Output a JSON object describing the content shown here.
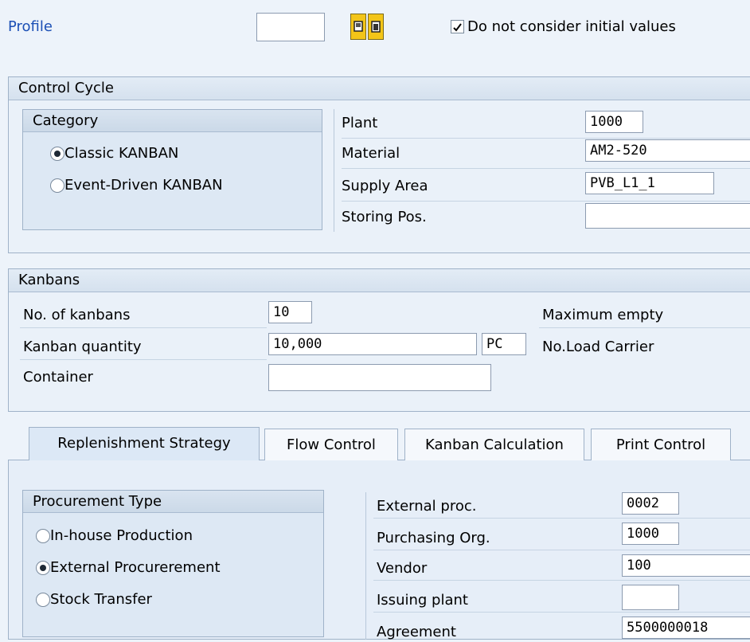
{
  "toolbar": {
    "profile_label": "Profile",
    "profile_value": "",
    "icon1": "expand-icon",
    "icon2": "collapse-icon",
    "checkbox_label": "Do not consider initial values",
    "checkbox_checked": true
  },
  "control_cycle": {
    "title": "Control Cycle",
    "category": {
      "title": "Category",
      "options": [
        {
          "label": "Classic KANBAN",
          "selected": true
        },
        {
          "label": "Event-Driven KANBAN",
          "selected": false
        }
      ]
    },
    "fields": [
      {
        "label": "Plant",
        "value": "1000"
      },
      {
        "label": "Material",
        "value": "AM2-520"
      },
      {
        "label": "Supply Area",
        "value": "PVB_L1_1"
      },
      {
        "label": "Storing Pos.",
        "value": ""
      }
    ]
  },
  "kanbans": {
    "title": "Kanbans",
    "no_kanbans_label": "No. of kanbans",
    "no_kanbans_value": "10",
    "quantity_label": "Kanban quantity",
    "quantity_value": "10,000",
    "unit_value": "PC",
    "container_label": "Container",
    "container_value": "",
    "max_empty_label": "Maximum empty",
    "load_carrier_label": "No.Load Carrier"
  },
  "tabs": [
    {
      "label": "Replenishment Strategy",
      "active": true
    },
    {
      "label": "Flow Control",
      "active": false
    },
    {
      "label": "Kanban Calculation",
      "active": false
    },
    {
      "label": "Print Control",
      "active": false
    }
  ],
  "replenishment": {
    "procurement_type": {
      "title": "Procurement Type",
      "options": [
        {
          "label": "In-house Production",
          "selected": false
        },
        {
          "label": "External Procurerement",
          "selected": true
        },
        {
          "label": "Stock Transfer",
          "selected": false
        }
      ]
    },
    "fields": [
      {
        "label": "External proc.",
        "value": "0002"
      },
      {
        "label": "Purchasing Org.",
        "value": "1000"
      },
      {
        "label": "Vendor",
        "value": "100"
      },
      {
        "label": "Issuing plant",
        "value": ""
      },
      {
        "label": "Agreement",
        "value": "5500000018"
      }
    ]
  }
}
